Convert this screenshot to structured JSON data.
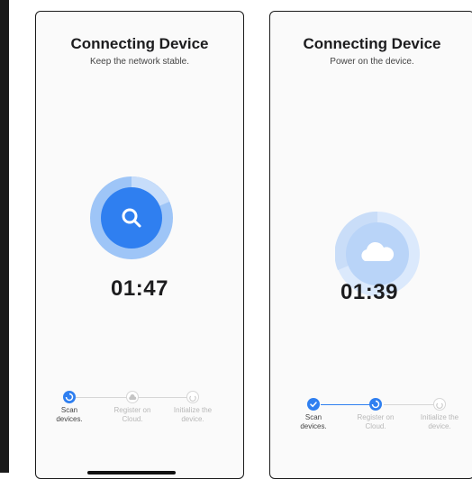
{
  "screens": [
    {
      "title": "Connecting Device",
      "subtitle": "Keep the network stable.",
      "timer": "01:47",
      "center_icon": "search-icon",
      "steps": [
        {
          "label": "Scan devices.",
          "state": "active",
          "icon": "spinner-icon"
        },
        {
          "label": "Register on Cloud.",
          "state": "pending",
          "icon": "cloud-icon"
        },
        {
          "label": "Initialize the device.",
          "state": "pending",
          "icon": "power-icon"
        }
      ]
    },
    {
      "title": "Connecting Device",
      "subtitle": "Power on the device.",
      "timer": "01:39",
      "center_icon": "cloud-icon",
      "steps": [
        {
          "label": "Scan devices.",
          "state": "done",
          "icon": "check-icon"
        },
        {
          "label": "Register on Cloud.",
          "state": "active",
          "icon": "spinner-icon"
        },
        {
          "label": "Initialize the device.",
          "state": "pending",
          "icon": "power-icon"
        }
      ]
    }
  ],
  "colors": {
    "accent": "#2f7ff0",
    "accent_light": "#9ec5f7",
    "accent_pale": "#dbe9fc",
    "muted": "#b8b8b8"
  }
}
